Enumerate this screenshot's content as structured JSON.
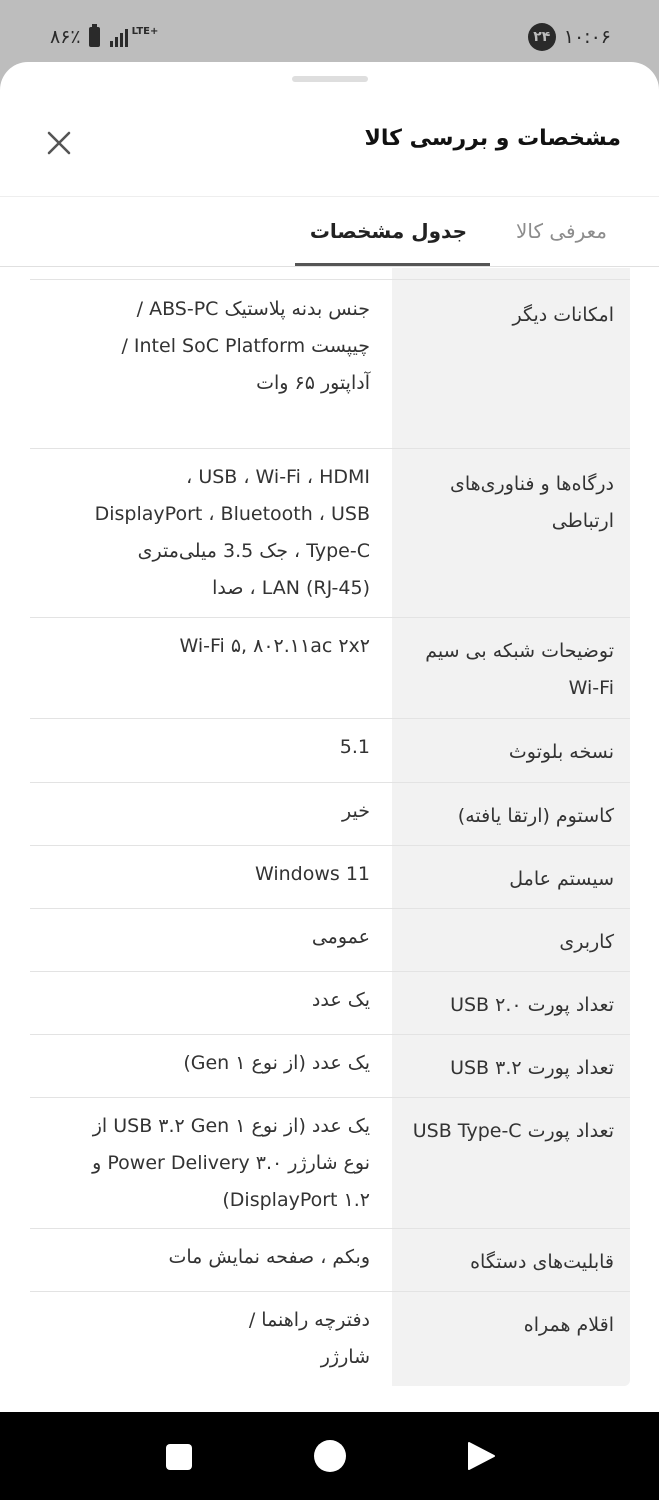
{
  "status_bar": {
    "battery": "۸۶٪",
    "network": "LTE+",
    "notification_count": "۲۴",
    "time": "۱۰:۰۶"
  },
  "sheet": {
    "title": "مشخصات و بررسی کالا"
  },
  "tabs": [
    {
      "label": "معرفی کالا",
      "active": false
    },
    {
      "label": "جدول مشخصات",
      "active": true
    }
  ],
  "specs": [
    {
      "label": "امکانات دیگر",
      "value": "جنس بدنه پلاستیک ABS-PC /\nچیپست Intel SoC Platform /\nآداپتور ۶۵ وات"
    },
    {
      "label": "درگاه‌ها و فناوری‌های ارتباطی",
      "value": "USB ، Wi-Fi ، HDMI ،\nDisplayPort ، Bluetooth ، USB\nType-C ، جک 3.5 میلی‌متری\n(LAN (RJ-45 ، صدا"
    },
    {
      "label": "توضیحات شبکه بی سیم Wi-Fi",
      "value": "Wi-Fi ۵, ۸۰۲.۱۱ac ۲x۲"
    },
    {
      "label": "نسخه بلوتوث",
      "value": "5.1"
    },
    {
      "label": "کاستوم (ارتقا یافته)",
      "value": "خیر"
    },
    {
      "label": "سیستم عامل",
      "value": "Windows 11"
    },
    {
      "label": "کاربری",
      "value": "عمومی"
    },
    {
      "label": "تعداد پورت USB ۲.۰",
      "value": "یک عدد"
    },
    {
      "label": "تعداد پورت USB ۳.۲",
      "value": "یک عدد (از نوع Gen ۱)"
    },
    {
      "label": "تعداد پورت USB Type-C",
      "value": "یک عدد (از نوع USB ۳.۲ Gen ۱ از\nنوع شارژر Power Delivery ۳.۰ و\nDisplayPort ۱.۲)"
    },
    {
      "label": "قابلیت‌های دستگاه",
      "value": "وبکم ، صفحه نمایش مات"
    },
    {
      "label": "اقلام همراه",
      "value": "دفترچه راهنما /\nشارژر"
    }
  ]
}
